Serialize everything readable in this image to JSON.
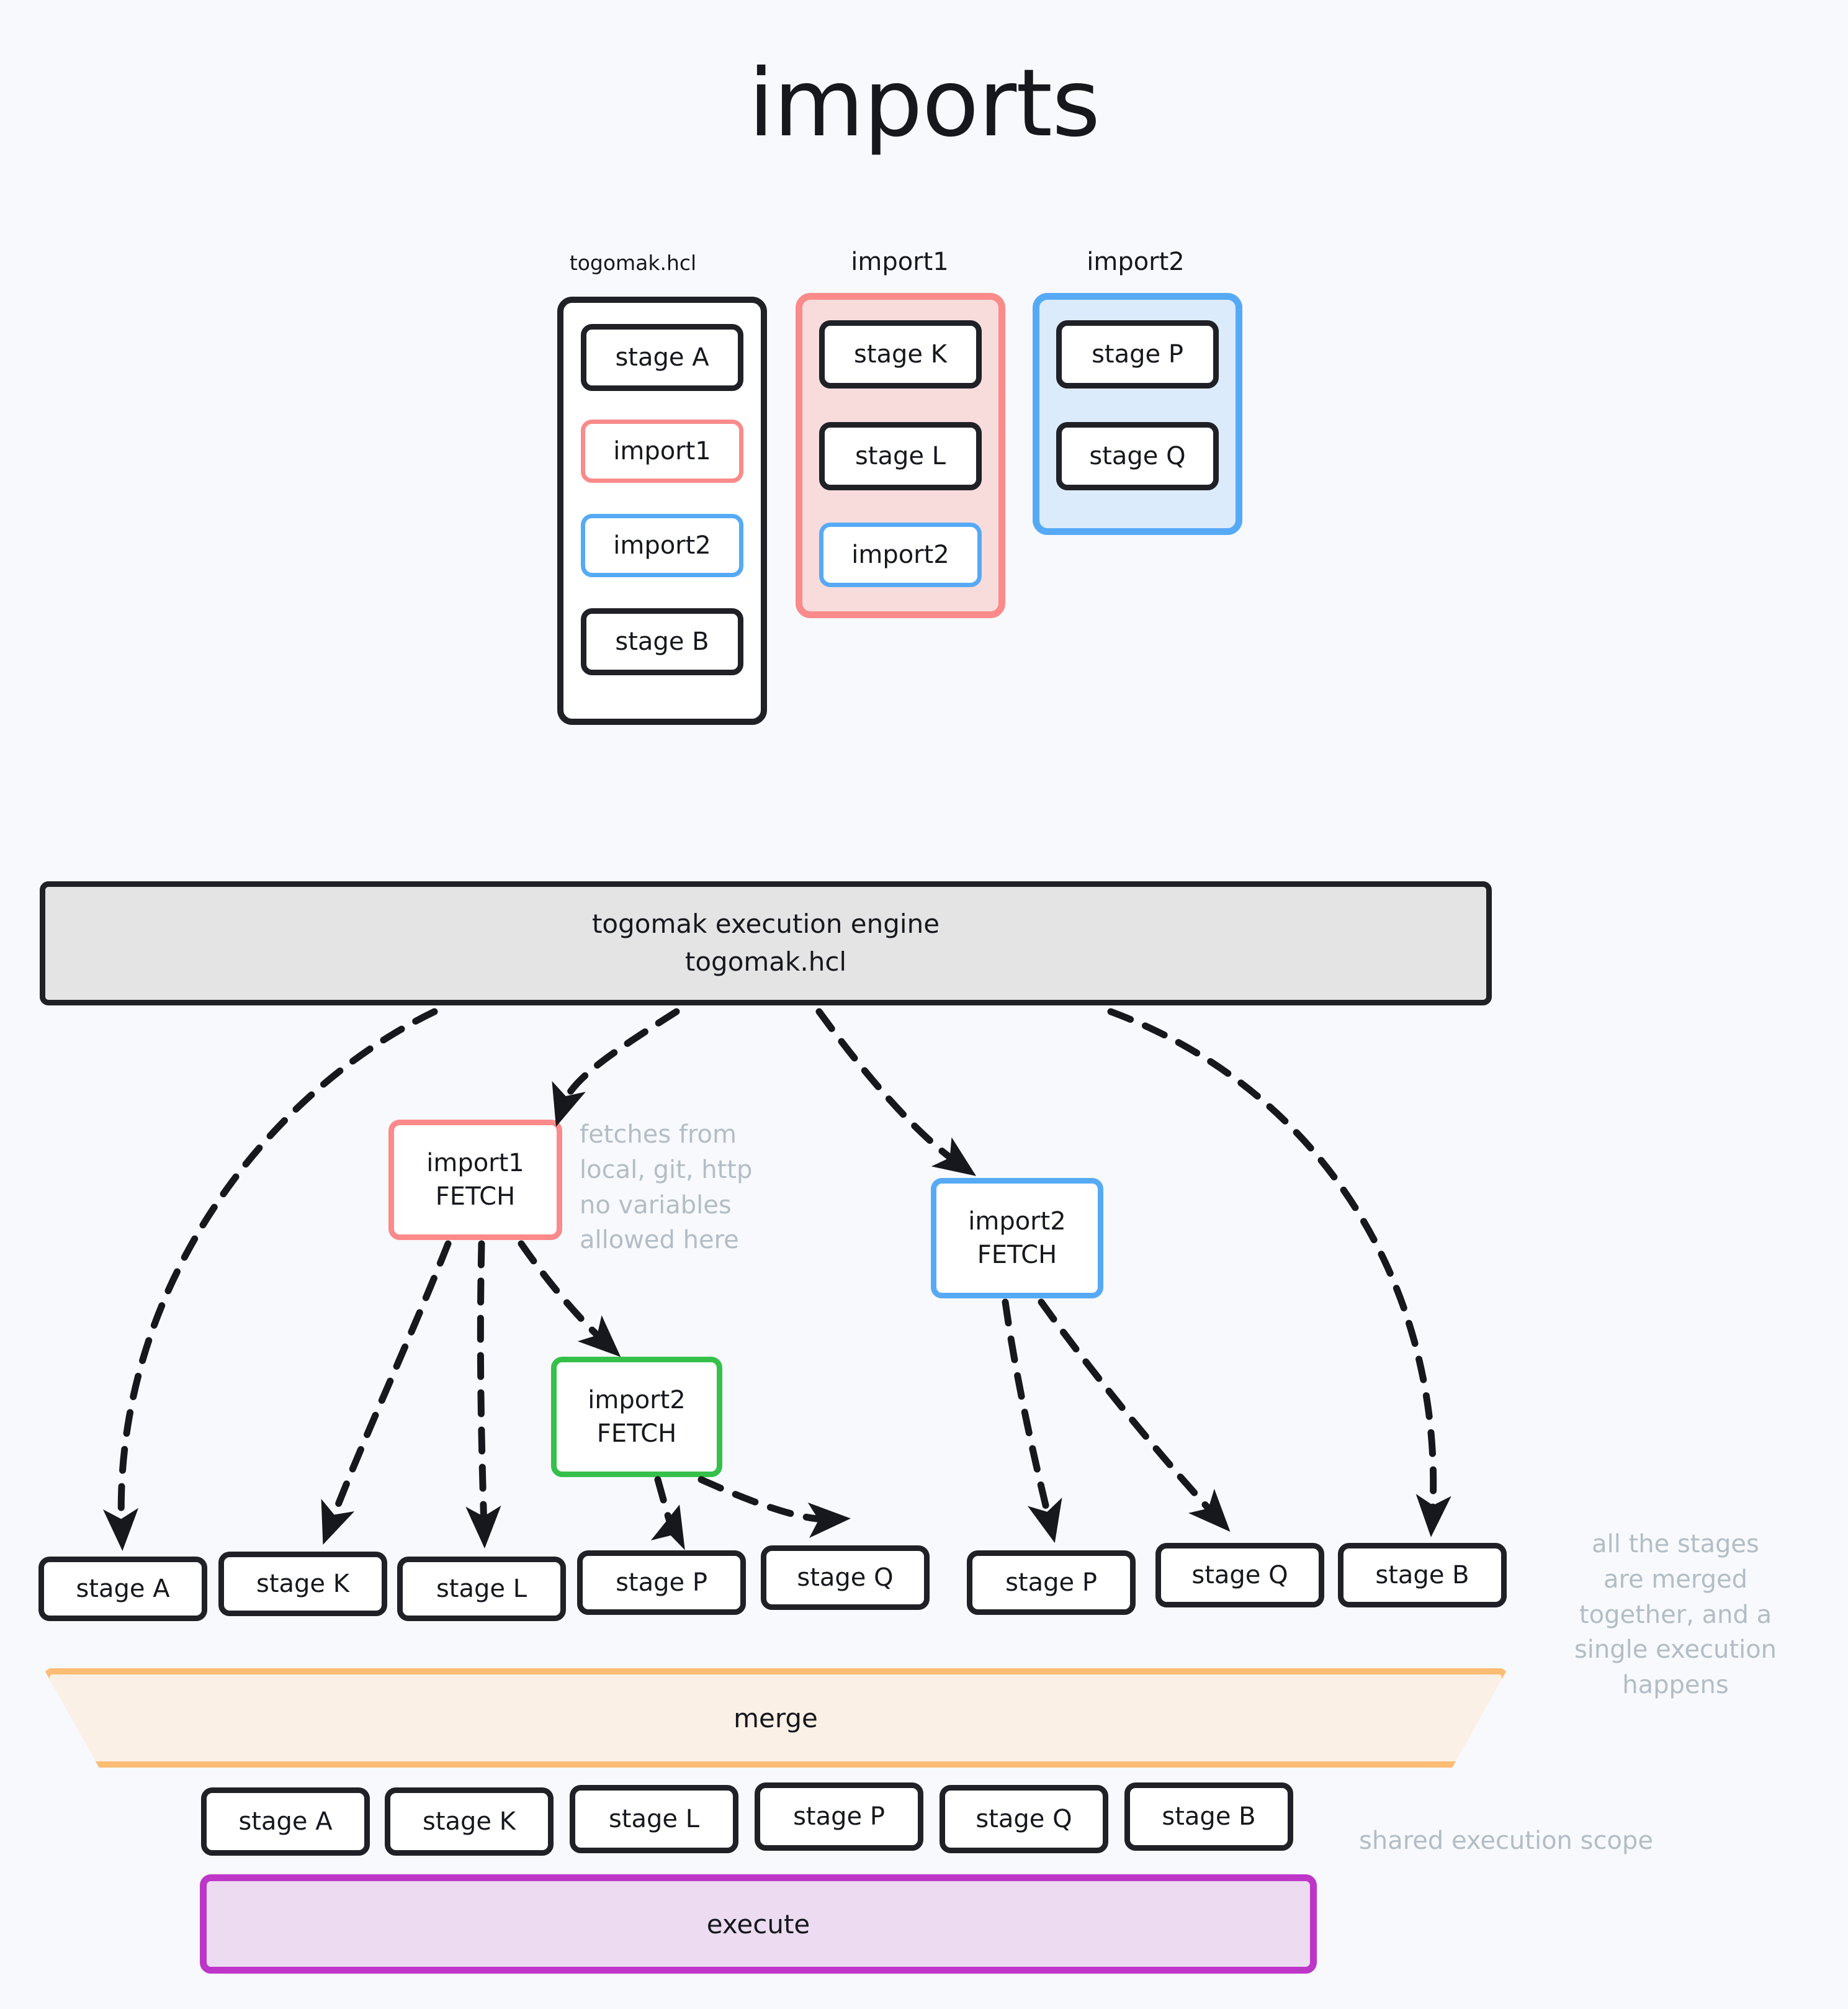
{
  "page": {
    "title": "imports",
    "background_color": "#f7f9fc"
  },
  "colors": {
    "red": "#fb8a8a",
    "red_fill": "#f8dcdc",
    "blue": "#56aaf5",
    "blue_fill": "#dcebfb",
    "green": "#35c04a",
    "orange": "#fbbd74",
    "orange_fill": "#faf0e6",
    "purple": "#bd36c7",
    "purple_fill": "#ecdbf1",
    "dark": "#1f2126",
    "note_gray": "#b3bdc6",
    "engine_fill": "#e4e4e4"
  },
  "files_section": {
    "files": [
      {
        "label": "togomak.hcl",
        "variant": "neutral",
        "stages": [
          {
            "label": "stage A",
            "variant": "neutral"
          },
          {
            "label": "import1",
            "variant": "red"
          },
          {
            "label": "import2",
            "variant": "blue"
          },
          {
            "label": "stage B",
            "variant": "neutral"
          }
        ]
      },
      {
        "label": "import1",
        "variant": "red",
        "stages": [
          {
            "label": "stage K",
            "variant": "neutral"
          },
          {
            "label": "stage L",
            "variant": "neutral"
          },
          {
            "label": "import2",
            "variant": "blue"
          }
        ]
      },
      {
        "label": "import2",
        "variant": "blue",
        "stages": [
          {
            "label": "stage P",
            "variant": "neutral"
          },
          {
            "label": "stage Q",
            "variant": "neutral"
          }
        ]
      }
    ]
  },
  "engine": {
    "line1": "togomak execution engine",
    "line2": "togomak.hcl"
  },
  "fetch_nodes": [
    {
      "id": "import1-fetch",
      "name": "import1",
      "action": "FETCH",
      "variant": "red"
    },
    {
      "id": "import2-fetch-nested",
      "name": "import2",
      "action": "FETCH",
      "variant": "green"
    },
    {
      "id": "import2-fetch-root",
      "name": "import2",
      "action": "FETCH",
      "variant": "blue"
    }
  ],
  "notes": {
    "fetch_note": "fetches from\nlocal, git, http\nno variables\nallowed here",
    "merge_note": "all the stages\nare merged\ntogether, and a\nsingle execution\nhappens",
    "scope_note": "shared execution scope"
  },
  "expanded_stages": [
    "stage A",
    "stage K",
    "stage L",
    "stage P",
    "stage Q",
    "stage P",
    "stage Q",
    "stage B"
  ],
  "merge": {
    "label": "merge"
  },
  "merged_stages": [
    "stage A",
    "stage K",
    "stage L",
    "stage P",
    "stage Q",
    "stage B"
  ],
  "execute": {
    "label": "execute"
  }
}
